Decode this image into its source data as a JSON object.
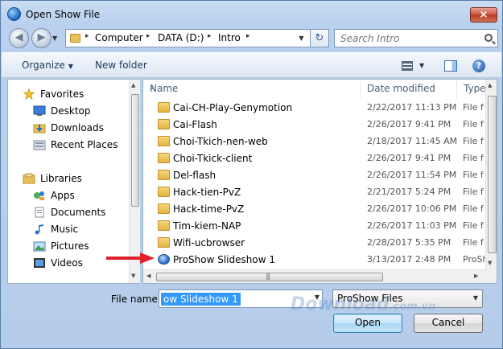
{
  "window": {
    "title": "Open Show File",
    "close_label": "×"
  },
  "address": {
    "crumbs": [
      "Computer",
      "DATA (D:)",
      "Intro"
    ],
    "separator": "▸"
  },
  "search": {
    "placeholder": "Search Intro"
  },
  "toolbar": {
    "organize_label": "Organize",
    "new_folder_label": "New folder",
    "help_label": "?"
  },
  "nav_pane": {
    "favorites_label": "Favorites",
    "favorites": [
      "Desktop",
      "Downloads",
      "Recent Places"
    ],
    "libraries_label": "Libraries",
    "libraries": [
      "Apps",
      "Documents",
      "Music",
      "Pictures",
      "Videos"
    ]
  },
  "file_list": {
    "columns": {
      "name": "Name",
      "date": "Date modified",
      "type": "Type"
    },
    "rows": [
      {
        "name": "Cai-CH-Play-Genymotion",
        "date": "2/22/2017 11:13 PM",
        "type": "File f",
        "kind": "folder"
      },
      {
        "name": "Cai-Flash",
        "date": "2/26/2017 9:41 PM",
        "type": "File f",
        "kind": "folder"
      },
      {
        "name": "Choi-Tkich-nen-web",
        "date": "2/18/2017 11:45 AM",
        "type": "File f",
        "kind": "folder"
      },
      {
        "name": "Choi-Tkick-client",
        "date": "2/26/2017 9:41 PM",
        "type": "File f",
        "kind": "folder"
      },
      {
        "name": "Del-flash",
        "date": "2/26/2017 11:54 PM",
        "type": "File f",
        "kind": "folder"
      },
      {
        "name": "Hack-tien-PvZ",
        "date": "2/21/2017 5:24 PM",
        "type": "File f",
        "kind": "folder"
      },
      {
        "name": "Hack-time-PvZ",
        "date": "2/26/2017 10:06 PM",
        "type": "File f",
        "kind": "folder"
      },
      {
        "name": "Tim-kiem-NAP",
        "date": "2/26/2017 11:03 PM",
        "type": "File f",
        "kind": "folder"
      },
      {
        "name": "Wifi-ucbrowser",
        "date": "2/28/2017 5:35 PM",
        "type": "File f",
        "kind": "folder"
      },
      {
        "name": "ProShow Slideshow 1",
        "date": "3/13/2017 2:48 PM",
        "type": "ProSh",
        "kind": "proshow"
      }
    ]
  },
  "bottom": {
    "filename_label": "File name:",
    "filename_value": "ow Slideshow 1",
    "filter_value": "ProShow Files",
    "open_label": "Open",
    "cancel_label": "Cancel"
  },
  "watermark": {
    "text": "Download",
    "suffix": ".com.vn"
  },
  "colors": {
    "annotation_arrow": "#e0202a",
    "selection": "#3399ff"
  }
}
